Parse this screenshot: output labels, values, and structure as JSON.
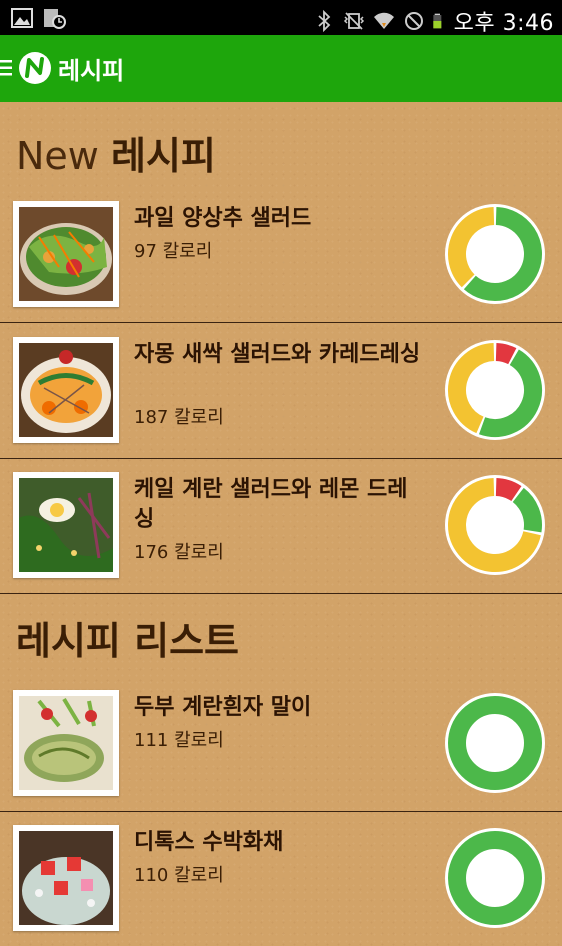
{
  "status_bar": {
    "time": "오후 3:46",
    "icons": [
      "gallery-icon",
      "calendar-clock-icon",
      "bluetooth-icon",
      "vibrate-icon",
      "wifi-icon",
      "no-signal-icon",
      "battery-icon"
    ]
  },
  "app_bar": {
    "title": "레시피",
    "menu_icon": "hamburger-menu-icon",
    "logo_icon": "app-logo-icon"
  },
  "sections": [
    {
      "header_en": "New",
      "header_ko": "레시피",
      "items": [
        {
          "title": "과일 양상추 샐러드",
          "calories": "97 칼로리",
          "nutrition": {
            "green": 0.62,
            "yellow": 0.38,
            "red": 0.0
          }
        },
        {
          "title": "자몽 새싹 샐러드와 카레드레싱",
          "calories": "187 칼로리",
          "nutrition": {
            "green": 0.48,
            "yellow": 0.44,
            "red": 0.08
          }
        },
        {
          "title": "케일 계란 샐러드와 레몬 드레싱",
          "calories": "176 칼로리",
          "nutrition": {
            "green": 0.18,
            "yellow": 0.72,
            "red": 0.1
          }
        }
      ]
    },
    {
      "header_ko": "레시피 리스트",
      "items": [
        {
          "title": "두부 계란흰자 말이",
          "calories": "111 칼로리",
          "nutrition": {
            "green": 1.0,
            "yellow": 0.0,
            "red": 0.0
          }
        },
        {
          "title": "디톡스 수박화채",
          "calories": "110 칼로리",
          "nutrition": {
            "green": 1.0,
            "yellow": 0.0,
            "red": 0.0
          }
        }
      ]
    }
  ],
  "colors": {
    "app_bar": "#1ea60c",
    "ring_green": "#4cb84a",
    "ring_yellow": "#f3c331",
    "ring_red": "#e2373f",
    "text": "#2b1303"
  }
}
